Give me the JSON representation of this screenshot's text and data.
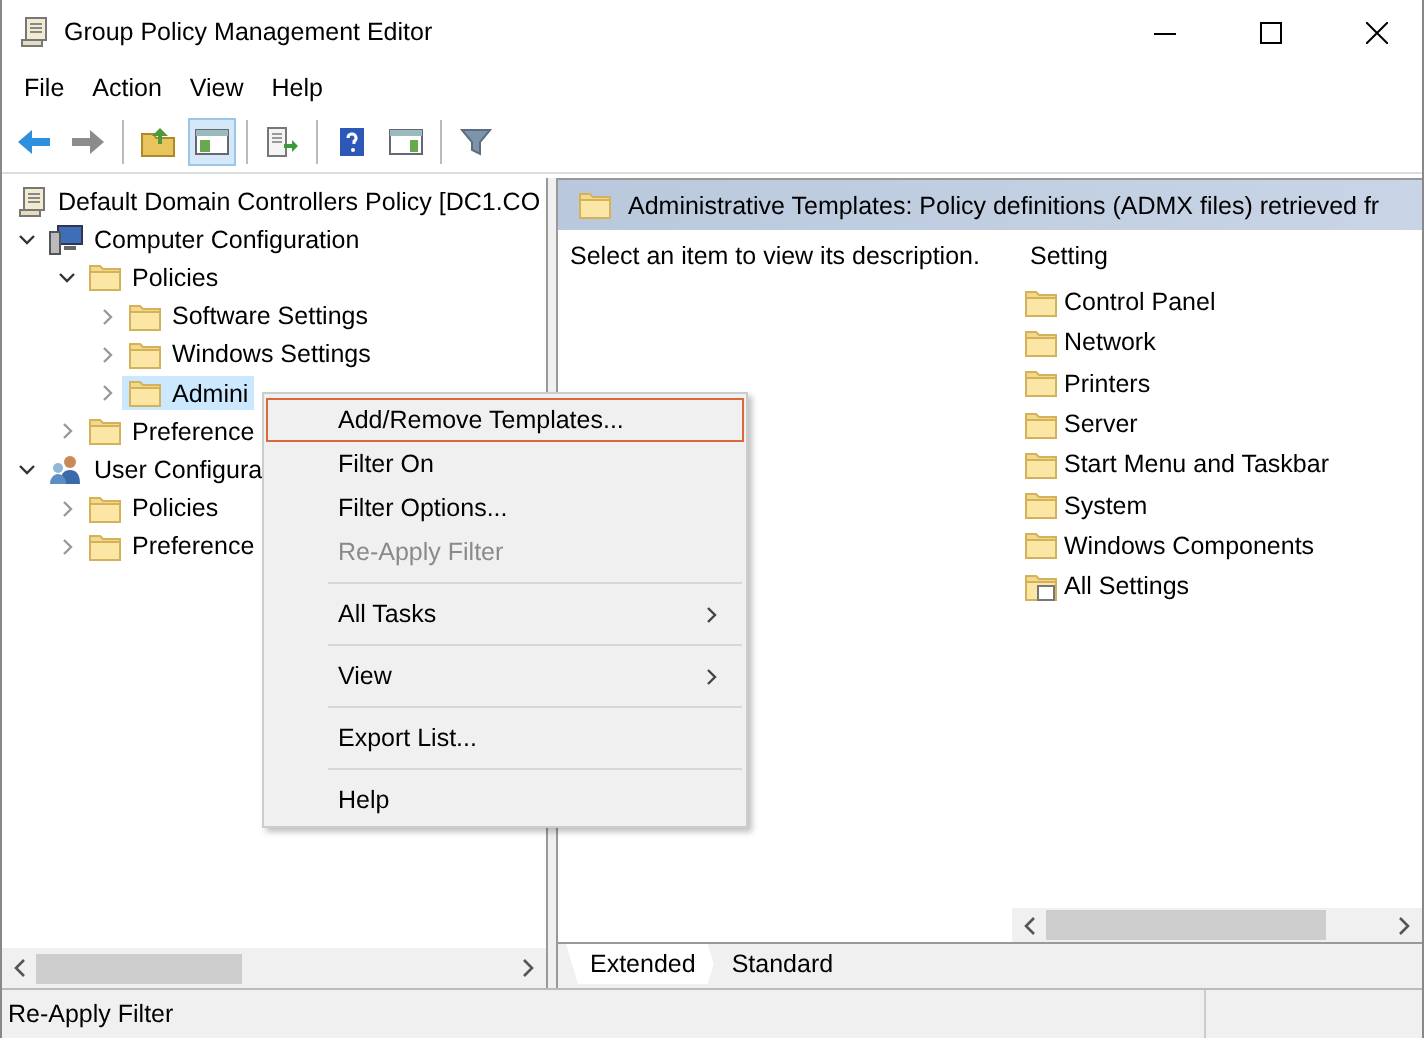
{
  "window": {
    "title": "Group Policy Management Editor"
  },
  "menu": [
    "File",
    "Action",
    "View",
    "Help"
  ],
  "toolbar": [
    {
      "kind": "back",
      "disabled": false,
      "selected": false
    },
    {
      "kind": "forward",
      "disabled": true,
      "selected": false
    },
    {
      "kind": "sep"
    },
    {
      "kind": "up",
      "disabled": false,
      "selected": false
    },
    {
      "kind": "tree",
      "disabled": false,
      "selected": true
    },
    {
      "kind": "sep"
    },
    {
      "kind": "export",
      "disabled": false,
      "selected": false
    },
    {
      "kind": "sep"
    },
    {
      "kind": "help",
      "disabled": false,
      "selected": false
    },
    {
      "kind": "pane",
      "disabled": false,
      "selected": false
    },
    {
      "kind": "sep"
    },
    {
      "kind": "filter",
      "disabled": false,
      "selected": false
    }
  ],
  "tree": [
    {
      "label": "Default Domain Controllers Policy [DC1.CO",
      "kind": "policy",
      "selected": false,
      "children": [
        {
          "label": "Computer Configuration",
          "kind": "computer",
          "expanded": true,
          "selected": false,
          "children": [
            {
              "label": "Policies",
              "kind": "folder",
              "expanded": true,
              "selected": false,
              "children": [
                {
                  "label": "Software Settings",
                  "kind": "folder",
                  "expanded": false,
                  "selected": false
                },
                {
                  "label": "Windows Settings",
                  "kind": "folder",
                  "expanded": false,
                  "selected": false
                },
                {
                  "label": "Admini",
                  "kind": "folder",
                  "expanded": false,
                  "selected": true
                }
              ]
            },
            {
              "label": "Preference",
              "kind": "folder",
              "expanded": false,
              "selected": false
            }
          ]
        },
        {
          "label": "User Configura",
          "kind": "user",
          "expanded": true,
          "selected": false,
          "children": [
            {
              "label": "Policies",
              "kind": "folder",
              "expanded": false,
              "selected": false
            },
            {
              "label": "Preference",
              "kind": "folder",
              "expanded": false,
              "selected": false
            }
          ]
        }
      ]
    }
  ],
  "details": {
    "header": "Administrative Templates: Policy definitions (ADMX files) retrieved fr",
    "description": "Select an item to view its description.",
    "column": "Setting",
    "items": [
      {
        "label": "Control Panel",
        "kind": "folder"
      },
      {
        "label": "Network",
        "kind": "folder"
      },
      {
        "label": "Printers",
        "kind": "folder"
      },
      {
        "label": "Server",
        "kind": "folder"
      },
      {
        "label": "Start Menu and Taskbar",
        "kind": "folder"
      },
      {
        "label": "System",
        "kind": "folder"
      },
      {
        "label": "Windows Components",
        "kind": "folder"
      },
      {
        "label": "All Settings",
        "kind": "all"
      }
    ]
  },
  "tabs": [
    {
      "label": "Extended",
      "selected": true
    },
    {
      "label": "Standard",
      "selected": false
    }
  ],
  "context_menu": {
    "groups": [
      [
        {
          "label": "Add/Remove Templates...",
          "disabled": false,
          "selected": true,
          "submenu": false
        },
        {
          "label": "Filter On",
          "disabled": false,
          "selected": false,
          "submenu": false
        },
        {
          "label": "Filter Options...",
          "disabled": false,
          "selected": false,
          "submenu": false
        },
        {
          "label": "Re-Apply Filter",
          "disabled": true,
          "selected": false,
          "submenu": false
        }
      ],
      [
        {
          "label": "All Tasks",
          "disabled": false,
          "selected": false,
          "submenu": true
        }
      ],
      [
        {
          "label": "View",
          "disabled": false,
          "selected": false,
          "submenu": true
        }
      ],
      [
        {
          "label": "Export List...",
          "disabled": false,
          "selected": false,
          "submenu": false
        }
      ],
      [
        {
          "label": "Help",
          "disabled": false,
          "selected": false,
          "submenu": false
        }
      ]
    ]
  },
  "status_bar": "Re-Apply Filter"
}
